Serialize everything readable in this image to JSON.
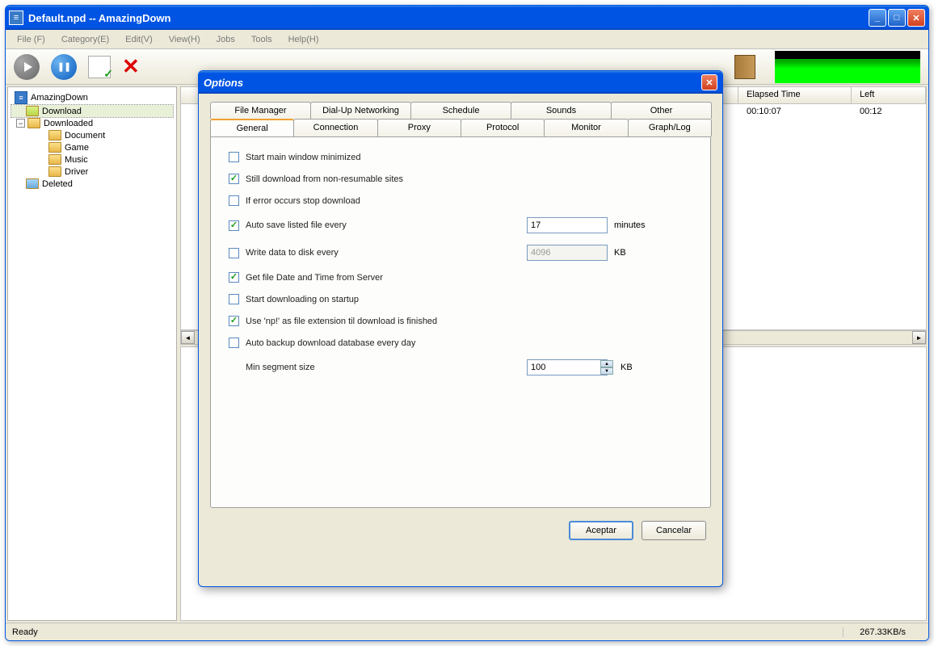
{
  "window": {
    "title": "Default.npd -- AmazingDown",
    "minimize": "_",
    "maximize": "□",
    "close": "✕"
  },
  "menu": [
    "File (F)",
    "Category(E)",
    "Edit(V)",
    "View(H)",
    "Jobs",
    "Tools",
    "Help(H)"
  ],
  "tree": {
    "root": "AmazingDown",
    "download": "Download",
    "downloaded": "Downloaded",
    "children": [
      "Document",
      "Game",
      "Music",
      "Driver"
    ],
    "deleted": "Deleted"
  },
  "columns": {
    "elapsed": "Elapsed Time",
    "left": "Left"
  },
  "row": {
    "elapsed": "00:10:07",
    "left": "00:12"
  },
  "status": {
    "ready": "Ready",
    "speed": "267.33KB/s"
  },
  "dialog": {
    "title": "Options",
    "tabs_top": [
      "File Manager",
      "Dial-Up Networking",
      "Schedule",
      "Sounds",
      "Other"
    ],
    "tabs_bottom": [
      "General",
      "Connection",
      "Proxy",
      "Protocol",
      "Monitor",
      "Graph/Log"
    ],
    "opts": {
      "start_min": "Start main window minimized",
      "still_dl": "Still download from non-resumable sites",
      "if_error": "If error occurs stop download",
      "auto_save": "Auto save listed file every",
      "auto_save_val": "17",
      "auto_save_unit": "minutes",
      "write_disk": "Write data to disk every",
      "write_disk_val": "4096",
      "write_disk_unit": "KB",
      "get_date": "Get file Date and Time from Server",
      "start_dl": "Start downloading on startup",
      "use_np": "Use 'np!' as file extension til download is finished",
      "auto_backup": "Auto backup download database every day",
      "min_seg": "Min segment size",
      "min_seg_val": "100",
      "min_seg_unit": "KB"
    },
    "accept": "Aceptar",
    "cancel": "Cancelar"
  }
}
